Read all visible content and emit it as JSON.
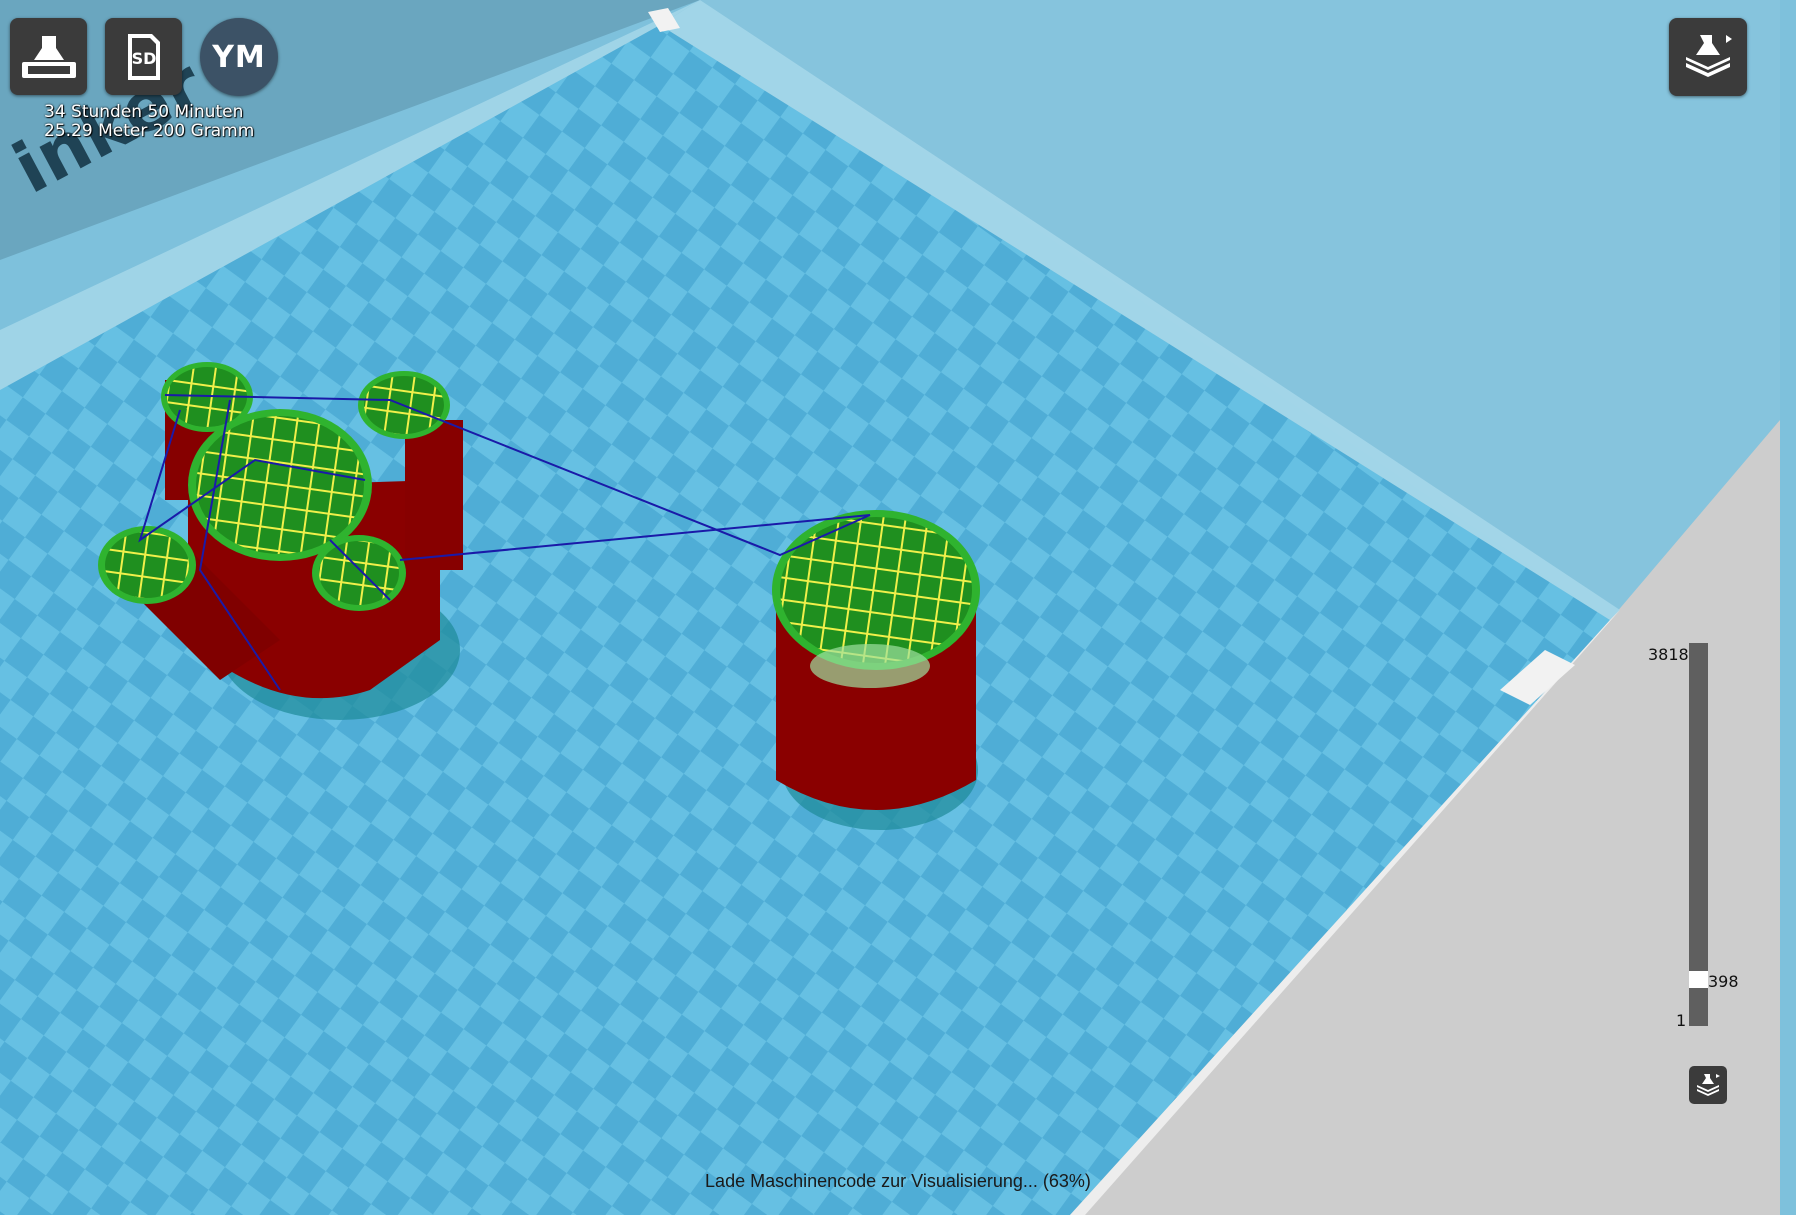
{
  "toolbar": {
    "save_icon": "save-to-printer-icon",
    "sd_label": "SD",
    "profile_initials": "YM",
    "view_icon": "layer-view-icon"
  },
  "print_info": {
    "duration": "34 Stunden 50 Minuten",
    "material": "25.29 Meter 200 Gramm"
  },
  "layer_slider": {
    "max_layer": "3818",
    "current_layer": "398",
    "min_layer": "1",
    "position_fraction": 0.104
  },
  "status": {
    "message": "Lade Maschinencode zur Visualisierung... (63%)"
  },
  "colors": {
    "build_plate_light": "#6fc6e6",
    "build_plate_dark": "#58b0d6",
    "wall_red": "#8a0000",
    "infill_yellow": "#f2f24a",
    "skin_green": "#2fb32f",
    "travel_blue": "#1a1aa8",
    "background_gray": "#cdcdcd"
  }
}
